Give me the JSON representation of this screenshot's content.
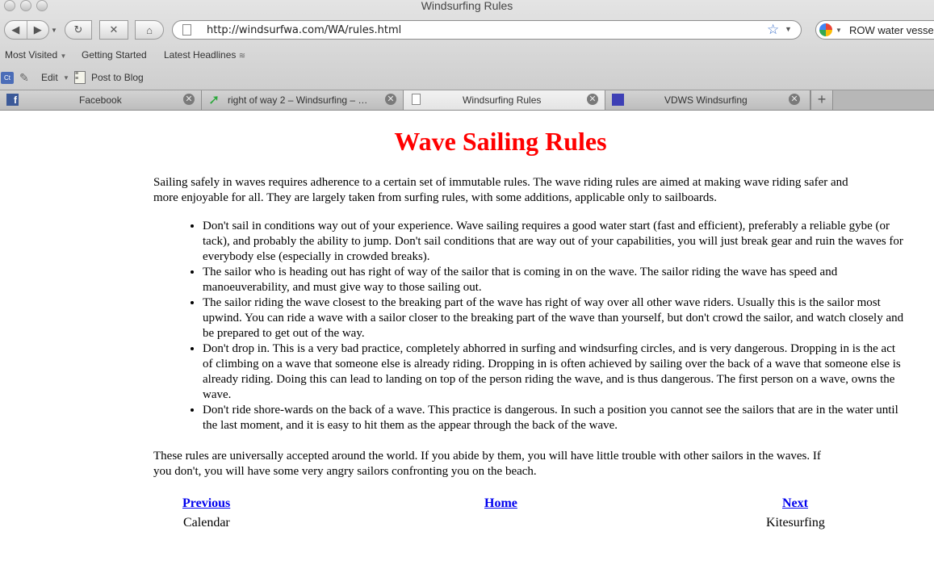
{
  "window": {
    "title": "Windsurfing Rules"
  },
  "navigation": {
    "back_icon": "back-arrow-icon",
    "forward_icon": "forward-arrow-icon",
    "reload_icon": "reload-icon",
    "stop_icon": "stop-icon",
    "home_icon": "home-icon",
    "url": "http://windsurfwa.com/WA/rules.html",
    "search_query": "ROW water vessels"
  },
  "bookmarks": [
    {
      "label": "Most Visited"
    },
    {
      "label": "Getting Started"
    },
    {
      "label": "Latest Headlines"
    }
  ],
  "toolbar": {
    "ct_badge": "Ct",
    "edit_label": "Edit",
    "post_label": "Post to Blog"
  },
  "tabs": [
    {
      "label": "Facebook",
      "icon": "facebook-icon",
      "active": false
    },
    {
      "label": "right of way 2 – Windsurfing – …",
      "icon": "green-arrow-icon",
      "active": false
    },
    {
      "label": "Windsurfing Rules",
      "icon": "page-icon",
      "active": true
    },
    {
      "label": "VDWS Windsurfing",
      "icon": "vdws-icon",
      "active": false
    }
  ],
  "page": {
    "title": "Wave Sailing Rules",
    "title_color": "#ff0000",
    "intro": "Sailing safely in waves requires adherence to a certain set of immutable rules. The wave riding rules are aimed at making wave riding safer and more enjoyable for all. They are largely taken from surfing rules, with some additions, applicable only to sailboards.",
    "rules": [
      "Don't sail in conditions way out of your experience. Wave sailing requires a good water start (fast and efficient), preferably a reliable gybe (or tack), and probably the ability to jump. Don't sail conditions that are way out of your capabilities, you will just break gear and ruin the waves for everybody else (especially in crowded breaks).",
      "The sailor who is heading out has right of way of the sailor that is coming in on the wave. The sailor riding the wave has speed and manoeuverability, and must give way to those sailing out.",
      "The sailor riding the wave closest to the breaking part of the wave has right of way over all other wave riders. Usually this is the sailor most upwind. You can ride a wave with a sailor closer to the breaking part of the wave than yourself, but don't crowd the sailor, and watch closely and be prepared to get out of the way.",
      "Don't drop in. This is a very bad practice, completely abhorred in surfing and windsurfing circles, and is very dangerous. Dropping in is the act of climbing on a wave that someone else is already riding. Dropping in is often achieved by sailing over the back of a wave that someone else is already riding. Doing this can lead to landing on top of the person riding the wave, and is thus dangerous. The first person on a wave, owns the wave.",
      "Don't ride shore-wards on the back of a wave. This practice is dangerous. In such a position you cannot see the sailors that are in the water until the last moment, and it is easy to hit them as the appear through the back of the wave."
    ],
    "outro": "These rules are universally accepted around the world. If you abide by them, you will have little trouble with other sailors in the waves. If you don't, you will have some very angry sailors confronting you on the beach.",
    "pager": {
      "previous_label": "Previous",
      "previous_sub": "Calendar",
      "home_label": "Home",
      "next_label": "Next",
      "next_sub": "Kitesurfing"
    },
    "link_color": "#0000ee"
  }
}
